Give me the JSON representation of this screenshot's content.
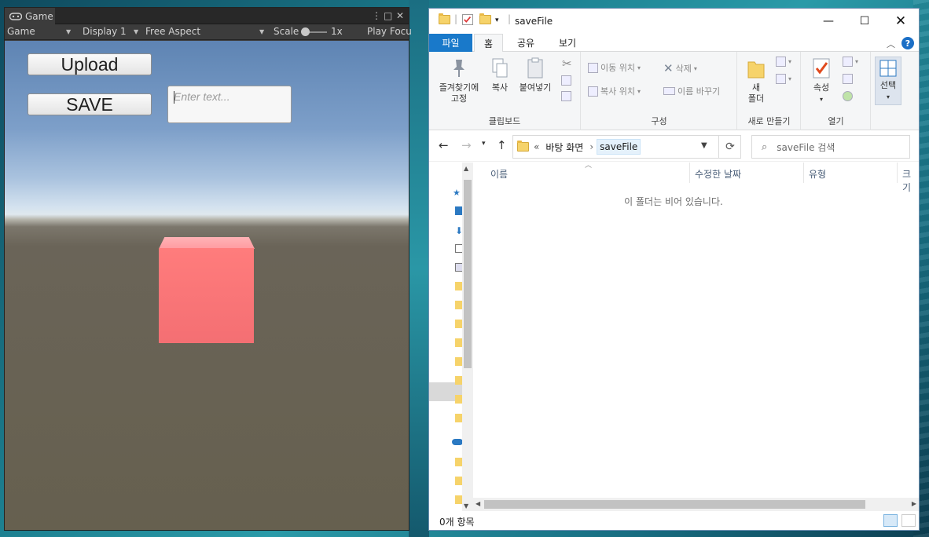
{
  "unity": {
    "tab_title": "Game",
    "toolbar": {
      "display_mode": "Game",
      "display": "Display 1",
      "aspect": "Free Aspect",
      "scale_label": "Scale",
      "scale_value": "1x",
      "play_focus": "Play Focu"
    },
    "game_ui": {
      "upload_label": "Upload",
      "save_label": "SAVE",
      "text_placeholder": "Enter text..."
    },
    "cube_color": "#f47275"
  },
  "explorer": {
    "window_title": "saveFile",
    "ribbon_tabs": [
      "파일",
      "홈",
      "공유",
      "보기"
    ],
    "clipboard": {
      "pin_label_1": "즐겨찾기에",
      "pin_label_2": "고정",
      "copy_label": "복사",
      "paste_label": "붙여넣기",
      "group_label": "클립보드"
    },
    "organize": {
      "move_to": "이동 위치",
      "copy_to": "복사 위치",
      "delete": "삭제",
      "rename": "이름 바꾸기",
      "group_label": "구성"
    },
    "new": {
      "new_folder_1": "새",
      "new_folder_2": "폴더",
      "group_label": "새로 만들기"
    },
    "open": {
      "properties": "속성",
      "group_label": "열기"
    },
    "select": {
      "label": "선택"
    },
    "address": {
      "overflow": "«",
      "crumb_1": "바탕 화면",
      "crumb_2": "saveFile"
    },
    "search_placeholder": "saveFile 검색",
    "columns": [
      "이름",
      "수정한 날짜",
      "유형",
      "크기"
    ],
    "empty_message": "이 폴더는 비어 있습니다.",
    "status_count": "0개 항목",
    "accent_color": "#1979ca"
  }
}
